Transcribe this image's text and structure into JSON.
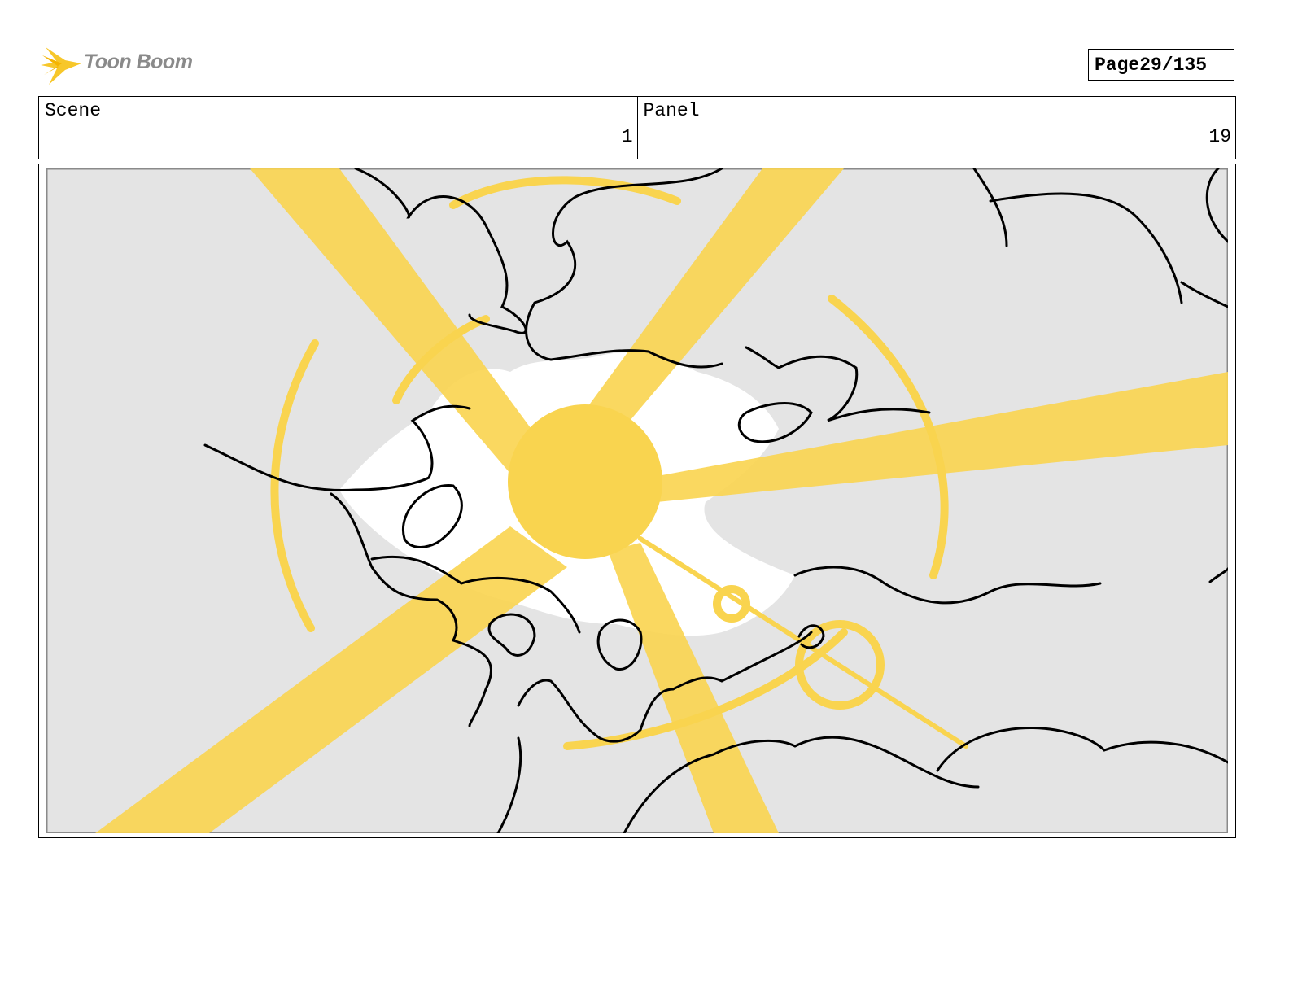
{
  "header": {
    "logo_text": "Toon Boom",
    "page_label": "Page",
    "page_number": "29/135"
  },
  "info": {
    "scene_label": "Scene",
    "scene_value": "1",
    "panel_label": "Panel",
    "panel_value": "19"
  },
  "colors": {
    "accent_yellow": "#f9d44f",
    "background_gray": "#e4e4e4",
    "ink": "#000000"
  }
}
